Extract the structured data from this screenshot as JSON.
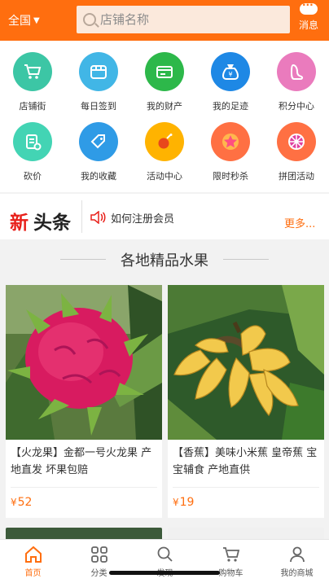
{
  "header": {
    "region": "全国",
    "search_placeholder": "店铺名称",
    "message_label": "消息"
  },
  "grid_items": [
    {
      "label": "店铺街",
      "icon": "shopping-cart-icon",
      "color": "#3cc6a5"
    },
    {
      "label": "每日签到",
      "icon": "store-icon",
      "color": "#41b6e6"
    },
    {
      "label": "我的财产",
      "icon": "wallet-icon",
      "color": "#2db84a"
    },
    {
      "label": "我的足迹",
      "icon": "money-bag-icon",
      "color": "#1e88e5"
    },
    {
      "label": "积分中心",
      "icon": "footprint-icon",
      "color": "#ea7bbd"
    },
    {
      "label": "砍价",
      "icon": "bargain-icon",
      "color": "#43d4b4"
    },
    {
      "label": "我的收藏",
      "icon": "tag-icon",
      "color": "#2f9be6"
    },
    {
      "label": "活动中心",
      "icon": "bomb-icon",
      "color": "#ffb300"
    },
    {
      "label": "限时秒杀",
      "icon": "star-icon",
      "color": "#ff7043"
    },
    {
      "label": "拼团活动",
      "icon": "wheel-icon",
      "color": "#ff7043"
    }
  ],
  "news": {
    "logo_new": "新",
    "logo_head": "头条",
    "text": "如何注册会员",
    "more": "更多..."
  },
  "section": {
    "title": "各地精品水果"
  },
  "products": [
    {
      "title": "【火龙果】金都一号火龙果 产地直发 坏果包赔",
      "currency": "¥",
      "price": "52"
    },
    {
      "title": "【香蕉】美味小米蕉 皇帝蕉 宝宝辅食 产地直供",
      "currency": "¥",
      "price": "19"
    }
  ],
  "tabbar": [
    {
      "label": "首页",
      "icon": "home-icon",
      "active": true
    },
    {
      "label": "分类",
      "icon": "grid-icon",
      "active": false
    },
    {
      "label": "发现",
      "icon": "search-icon",
      "active": false
    },
    {
      "label": "购物车",
      "icon": "cart-icon",
      "active": false
    },
    {
      "label": "我的商城",
      "icon": "user-icon",
      "active": false
    }
  ],
  "colors": {
    "accent": "#ff6e0f",
    "price": "#ff6e0f"
  }
}
